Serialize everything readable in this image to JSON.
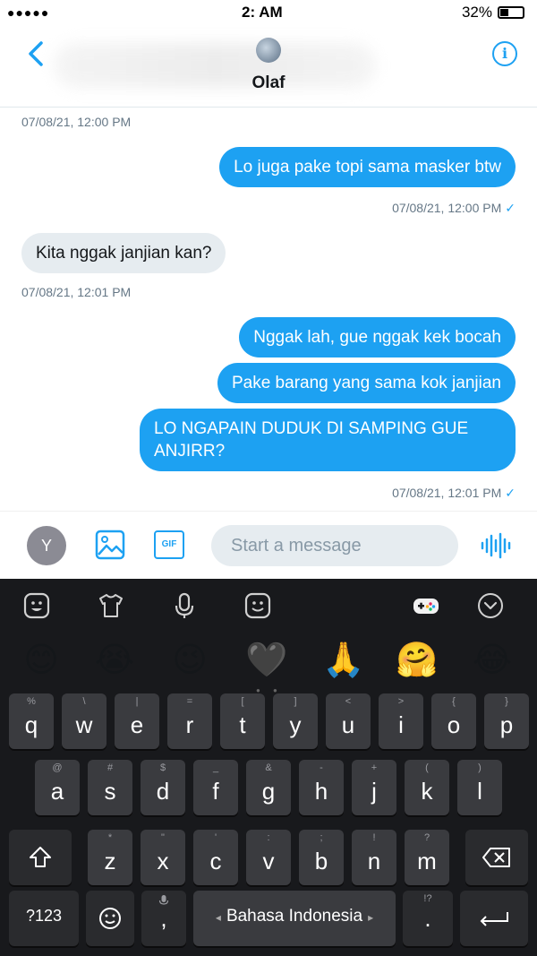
{
  "status_bar": {
    "signal": "●●●●● ",
    "time": "2:  AM",
    "battery": "32%"
  },
  "header": {
    "contact_name": "Olaf",
    "back_icon": "chevron-left-icon",
    "info_icon": "info-icon",
    "info_glyph": "i"
  },
  "messages": [
    {
      "type": "timestamp",
      "text": "07/08/21, 12:00 PM"
    },
    {
      "type": "out",
      "text": "Lo juga pake topi sama masker btw"
    },
    {
      "type": "timestamp_out",
      "text": "07/08/21, 12:00 PM",
      "check": "✓"
    },
    {
      "type": "in",
      "text": "Kita nggak janjian kan?"
    },
    {
      "type": "timestamp",
      "text": "07/08/21, 12:01 PM"
    },
    {
      "type": "out",
      "text": "Nggak lah, gue nggak kek bocah"
    },
    {
      "type": "out",
      "text": "Pake barang yang sama kok janjian"
    },
    {
      "type": "out",
      "text": "LO NGAPAIN DUDUK DI SAMPING GUE ANJIRR?"
    },
    {
      "type": "timestamp_out",
      "text": "07/08/21, 12:01 PM",
      "check": "✓"
    }
  ],
  "composer": {
    "avatar_letter": "Y",
    "gif_label": "GIF",
    "placeholder": "Start a message"
  },
  "keyboard": {
    "emojis": [
      "😊",
      "😭",
      "😉",
      "🖤",
      "🙏",
      "🤗",
      "😂"
    ],
    "row1": [
      {
        "main": "q",
        "hint": "%"
      },
      {
        "main": "w",
        "hint": "\\"
      },
      {
        "main": "e",
        "hint": "|"
      },
      {
        "main": "r",
        "hint": "="
      },
      {
        "main": "t",
        "hint": "["
      },
      {
        "main": "y",
        "hint": "]"
      },
      {
        "main": "u",
        "hint": "<"
      },
      {
        "main": "i",
        "hint": ">"
      },
      {
        "main": "o",
        "hint": "{"
      },
      {
        "main": "p",
        "hint": "}"
      }
    ],
    "row2": [
      {
        "main": "a",
        "hint": "@"
      },
      {
        "main": "s",
        "hint": "#"
      },
      {
        "main": "d",
        "hint": "$"
      },
      {
        "main": "f",
        "hint": "_"
      },
      {
        "main": "g",
        "hint": "&"
      },
      {
        "main": "h",
        "hint": "-"
      },
      {
        "main": "j",
        "hint": "+"
      },
      {
        "main": "k",
        "hint": "("
      },
      {
        "main": "l",
        "hint": ")"
      }
    ],
    "row3": [
      {
        "main": "z",
        "hint": "*"
      },
      {
        "main": "x",
        "hint": "\""
      },
      {
        "main": "c",
        "hint": "'"
      },
      {
        "main": "v",
        "hint": ":"
      },
      {
        "main": "b",
        "hint": ";"
      },
      {
        "main": "n",
        "hint": "!"
      },
      {
        "main": "m",
        "hint": "?"
      }
    ],
    "numbers_label": "?123",
    "comma": ",",
    "space_label": "Bahasa Indonesia",
    "space_left": "◂",
    "space_right": "▸",
    "period": ".",
    "period_hint": "!?"
  }
}
